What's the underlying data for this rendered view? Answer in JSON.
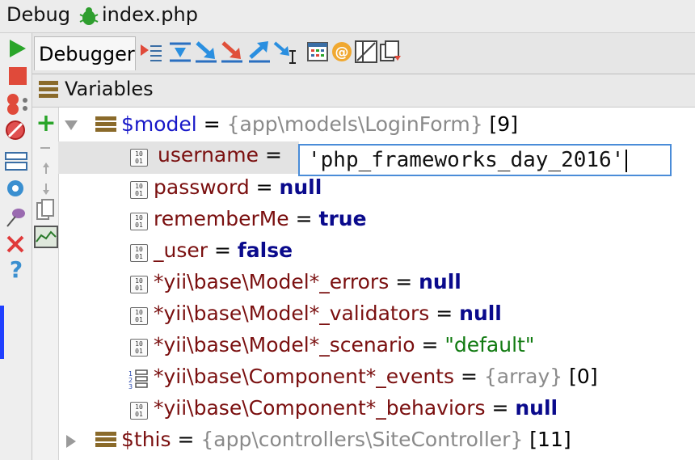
{
  "window": {
    "title_prefix": "Debug",
    "title_file": "index.php"
  },
  "tabs": {
    "debugger": "Debugger"
  },
  "panel": {
    "variables_label": "Variables"
  },
  "tree": {
    "model": {
      "name": "$model",
      "eq": " = ",
      "type": "{app\\models\\LoginForm}",
      "count": " [9]"
    },
    "username": {
      "name": "username",
      "eq": " = ",
      "edit_value": "'php_frameworks_day_2016'"
    },
    "password": {
      "name": "password",
      "eq": " = ",
      "value": "null"
    },
    "rememberMe": {
      "name": "rememberMe",
      "eq": " = ",
      "value": "true"
    },
    "user": {
      "name": "_user",
      "eq": " = ",
      "value": "false"
    },
    "errors": {
      "name": "*yii\\base\\Model*_errors",
      "eq": " = ",
      "value": "null"
    },
    "validators": {
      "name": "*yii\\base\\Model*_validators",
      "eq": " = ",
      "value": "null"
    },
    "scenario": {
      "name": "*yii\\base\\Model*_scenario",
      "eq": " = ",
      "value": "\"default\""
    },
    "events": {
      "name": "*yii\\base\\Component*_events",
      "eq": " = ",
      "type": "{array}",
      "count": " [0]"
    },
    "behaviors": {
      "name": "*yii\\base\\Component*_behaviors",
      "eq": " = ",
      "value": "null"
    },
    "this": {
      "name": "$this",
      "eq": " = ",
      "type": "{app\\controllers\\SiteController}",
      "count": " [11]"
    }
  },
  "icons": {
    "bin_text": "10\n01",
    "colors": {
      "resume": "#2aa52a",
      "stop": "#e04a3a",
      "accent": "#4a8cd8",
      "selection_row": "#e3e3e3"
    }
  }
}
